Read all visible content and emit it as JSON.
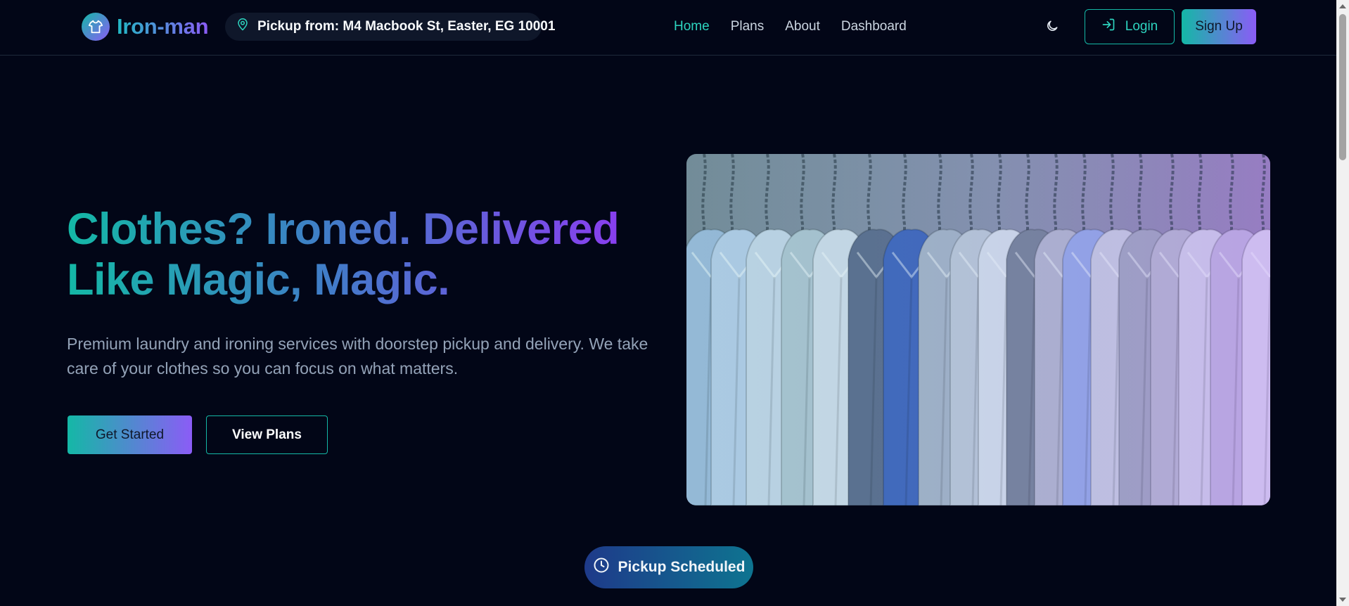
{
  "brand": {
    "name": "Iron-man",
    "logo_icon": "shirt-icon",
    "gradient_start": "#14b8a6",
    "gradient_end": "#8b5cf6"
  },
  "pickup": {
    "text": "Pickup from: M4 Macbook St, Easter, EG 10001",
    "icon": "map-pin-icon"
  },
  "nav": {
    "items": [
      {
        "label": "Home",
        "active": true
      },
      {
        "label": "Plans",
        "active": false
      },
      {
        "label": "About",
        "active": false
      },
      {
        "label": "Dashboard",
        "active": false
      }
    ]
  },
  "header_actions": {
    "theme_icon": "moon-icon",
    "login_label": "Login",
    "login_icon": "login-icon",
    "signup_label": "Sign Up"
  },
  "hero": {
    "title_line1": "Clothes? Ironed. Delivered",
    "title_line2": "Like Magic, Magic.",
    "description": "Premium laundry and ironing services with doorstep pickup and delivery. We take care of your clothes so you can focus on what matters.",
    "primary_cta": "Get Started",
    "secondary_cta": "View Plans"
  },
  "status": {
    "label": "Pickup Scheduled",
    "icon": "clock-icon"
  },
  "colors": {
    "background": "#020617",
    "accent": "#2dd4bf",
    "muted_text": "#94a3b8"
  }
}
